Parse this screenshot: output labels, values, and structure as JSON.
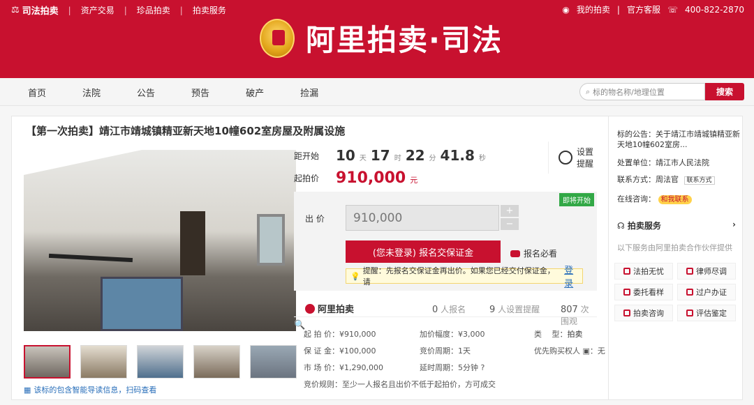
{
  "topbar": {
    "brand": "司法拍卖",
    "links": [
      "资产交易",
      "珍品拍卖",
      "拍卖服务"
    ],
    "my_auction": "我的拍卖",
    "service": "官方客服",
    "phone": "400-822-2870",
    "logo_title": "阿里拍卖·司法"
  },
  "nav": {
    "items": [
      "首页",
      "法院",
      "公告",
      "预告",
      "破产",
      "捡漏"
    ],
    "search_placeholder": "标的物名称/地理位置",
    "search_button": "搜索"
  },
  "item": {
    "title": "【第一次拍卖】靖江市靖城镇精亚新天地10幢602室房屋及附属设施",
    "qr_text": "该标的包含智能导读信息，扫码查看"
  },
  "countdown": {
    "label": "距开始",
    "days": "10",
    "days_unit": "天",
    "hours": "17",
    "hours_unit": "时",
    "minutes": "22",
    "minutes_unit": "分",
    "seconds": "41.8",
    "seconds_unit": "秒",
    "reminder_line1": "设置",
    "reminder_line2": "提醒",
    "start_price_label": "起拍价",
    "start_price": "910,000",
    "start_price_unit": "元"
  },
  "bid": {
    "tag": "即将开始",
    "label": "出 价",
    "value": "910,000",
    "register_button": "(您未登录) 报名交保证金",
    "must_read": "报名必看",
    "tip": "提醒：先报名交保证金再出价。如果您已经交付保证金，请",
    "login": "登录"
  },
  "stats": {
    "brand": "阿里拍卖",
    "signup_count": "0",
    "signup_label": "人报名",
    "remind_count": "9",
    "remind_label": "人设置提醒",
    "view_count": "807",
    "view_label": "次围观"
  },
  "details": {
    "start_price": "起 拍 价：¥910,000",
    "deposit": "保 证 金：¥100,000",
    "market_price": "市 场 价：¥1,290,000",
    "increment": "加价幅度：¥3,000",
    "period": "竞价周期：1天",
    "delay": "延时周期：5分钟",
    "type": "类　 型：",
    "type_value": "拍卖",
    "priority": "优先购买权人",
    "priority_value": "无",
    "rule": "竞价规则：至少一人报名且出价不低于起拍价，方可成交"
  },
  "sidebar": {
    "notice_label": "标的公告：",
    "notice_text": "关于靖江市靖城镇精亚新天地10幢602室房...",
    "court_label": "处置单位：",
    "court": "靖江市人民法院",
    "contact_label": "联系方式：",
    "contact": "周法官",
    "contact_btn": "联系方式",
    "online_label": "在线咨询：",
    "online_btn": "和我联系",
    "service_title": "拍卖服务",
    "service_desc": "以下服务由阿里拍卖合作伙伴提供",
    "buttons": [
      "法拍无忧",
      "律师尽调",
      "委托看样",
      "过户办证",
      "拍卖咨询",
      "评估鉴定"
    ]
  }
}
